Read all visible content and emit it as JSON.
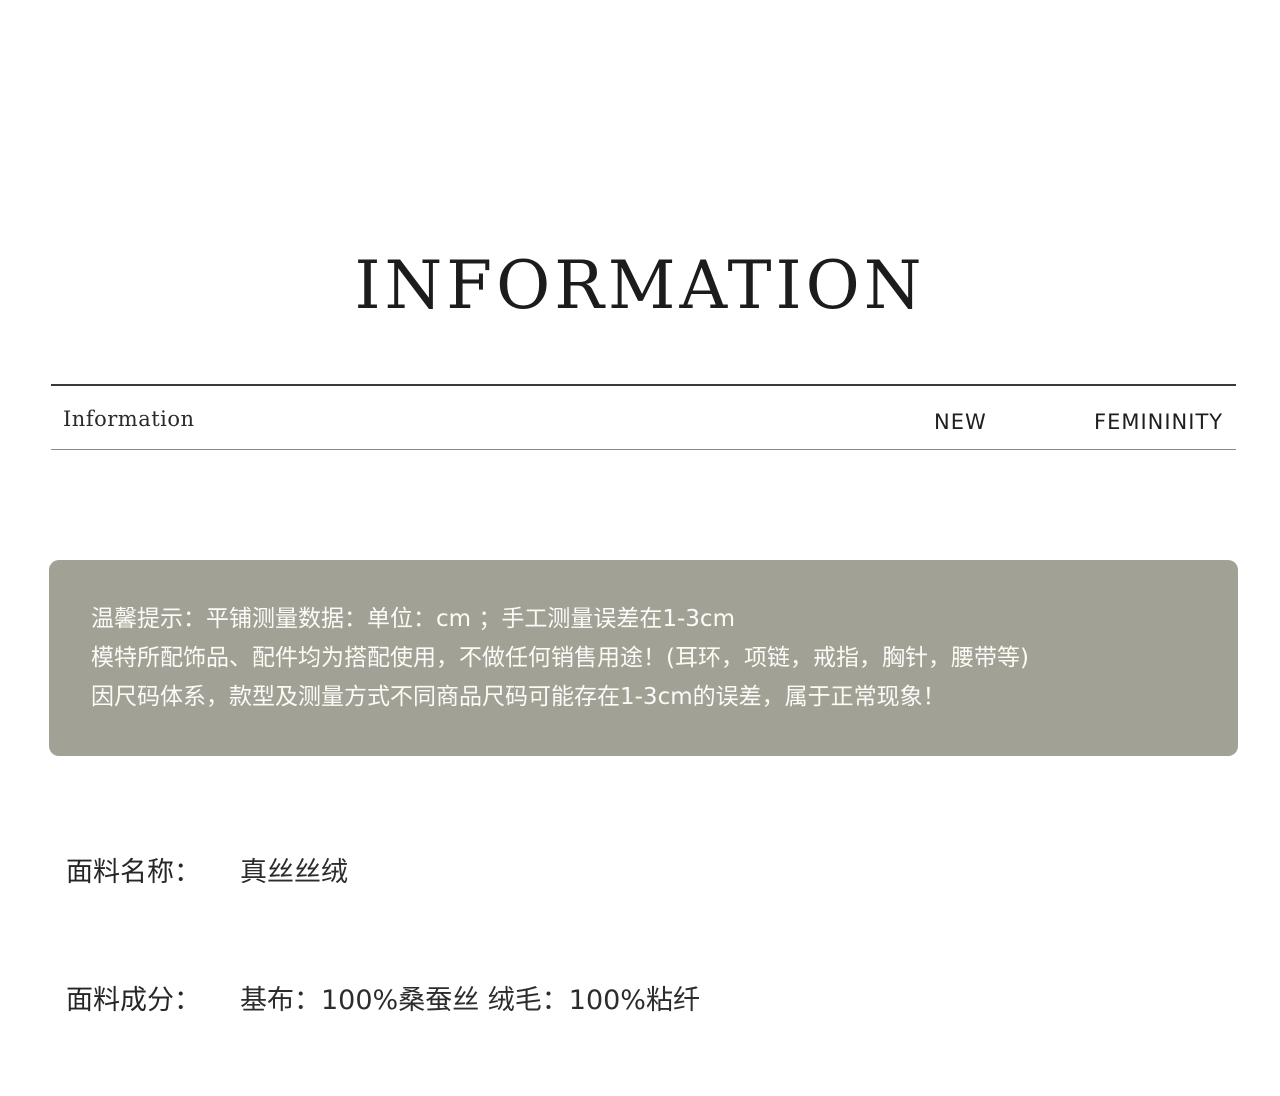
{
  "header": {
    "title": "INFORMATION"
  },
  "section_bar": {
    "left_label": "Information",
    "right_label_1": "NEW",
    "right_label_2": "FEMININITY"
  },
  "notice": {
    "lines": [
      "温馨提示：平铺测量数据：单位：cm ；手工测量误差在1-3cm",
      "模特所配饰品、配件均为搭配使用，不做任何销售用途！(耳环，项链，戒指，胸针，腰带等)",
      "因尺码体系，款型及测量方式不同商品尺码可能存在1-3cm的误差，属于正常现象！"
    ],
    "background_color": "#a1a195",
    "text_color": "#fbfbf7"
  },
  "specs": [
    {
      "label": "面料名称：",
      "value": "真丝丝绒"
    },
    {
      "label": "面料成分：",
      "value": "基布：100%桑蚕丝 绒毛：100%粘纤"
    }
  ]
}
